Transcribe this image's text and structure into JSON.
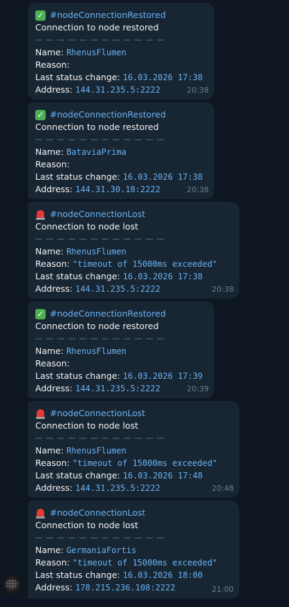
{
  "messages": [
    {
      "hashtag": "#nodeConnectionRestored",
      "title": "Connection to node restored",
      "name_label": "Name:",
      "name": "RhenusFlumen",
      "reason_label": "Reason:",
      "reason": "",
      "status_label": "Last status change:",
      "status": "16.03.2026 17:38",
      "address_label": "Address:",
      "address": "144.31.235.5:2222",
      "time": "20:38",
      "type": "restored",
      "emoji_icon": "check-mark-button-icon"
    },
    {
      "hashtag": "#nodeConnectionRestored",
      "title": "Connection to node restored",
      "name_label": "Name:",
      "name": "BataviaPrima",
      "reason_label": "Reason:",
      "reason": "",
      "status_label": "Last status change:",
      "status": "16.03.2026 17:38",
      "address_label": "Address:",
      "address": "144.31.30.18:2222",
      "time": "20:38",
      "type": "restored",
      "emoji_icon": "check-mark-button-icon"
    },
    {
      "hashtag": "#nodeConnectionLost",
      "title": "Connection to node lost",
      "name_label": "Name:",
      "name": "RhenusFlumen",
      "reason_label": "Reason:",
      "reason": "\"timeout of 15000ms exceeded\"",
      "status_label": "Last status change:",
      "status": "16.03.2026 17:38",
      "address_label": "Address:",
      "address": "144.31.235.5:2222",
      "time": "20:38",
      "type": "lost",
      "emoji_icon": "police-light-icon"
    },
    {
      "hashtag": "#nodeConnectionRestored",
      "title": "Connection to node restored",
      "name_label": "Name:",
      "name": "RhenusFlumen",
      "reason_label": "Reason:",
      "reason": "",
      "status_label": "Last status change:",
      "status": "16.03.2026 17:39",
      "address_label": "Address:",
      "address": "144.31.235.5:2222",
      "time": "20:39",
      "type": "restored",
      "emoji_icon": "check-mark-button-icon"
    },
    {
      "hashtag": "#nodeConnectionLost",
      "title": "Connection to node lost",
      "name_label": "Name:",
      "name": "RhenusFlumen",
      "reason_label": "Reason:",
      "reason": "\"timeout of 15000ms exceeded\"",
      "status_label": "Last status change:",
      "status": "16.03.2026 17:48",
      "address_label": "Address:",
      "address": "144.31.235.5:2222",
      "time": "20:48",
      "type": "lost",
      "emoji_icon": "police-light-icon"
    },
    {
      "hashtag": "#nodeConnectionLost",
      "title": "Connection to node lost",
      "name_label": "Name:",
      "name": "GermaniaFortis",
      "reason_label": "Reason:",
      "reason": "\"timeout of 15000ms exceeded\"",
      "status_label": "Last status change:",
      "status": "16.03.2026 18:00",
      "address_label": "Address:",
      "address": "178.215.236.108:2222",
      "time": "21:00",
      "type": "lost",
      "emoji_icon": "police-light-icon"
    }
  ],
  "colors": {
    "background": "#0e1621",
    "bubble": "#182533",
    "link": "#6ab3f3",
    "time": "#6d7f8f"
  },
  "avatar_icon": "bot-avatar-icon"
}
